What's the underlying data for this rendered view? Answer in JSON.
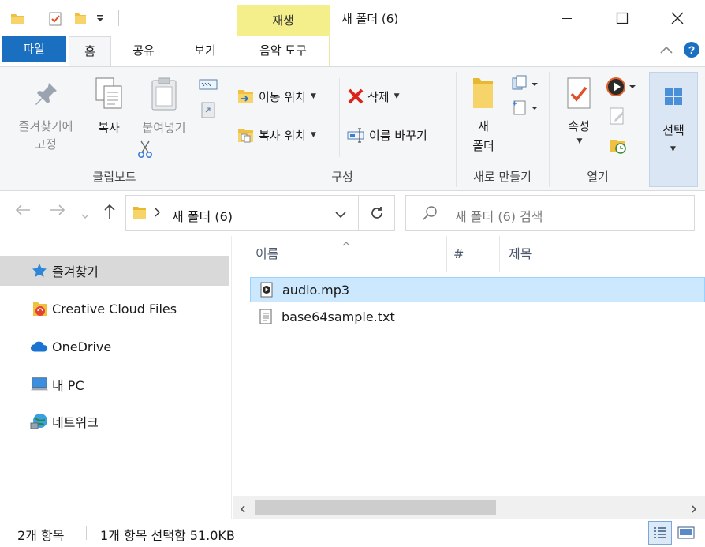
{
  "window": {
    "title": "새 폴더 (6)",
    "context_tab_group": "재생",
    "qat_icons": [
      "folder-icon",
      "properties-icon",
      "new-folder-icon",
      "qat-dropdown-icon"
    ],
    "controls": [
      "minimize-icon",
      "maximize-icon",
      "close-icon"
    ]
  },
  "tabs": {
    "file": "파일",
    "home": "홈",
    "share": "공유",
    "view": "보기",
    "music_tools": "음악 도구"
  },
  "ribbon": {
    "clipboard": {
      "pin_line1": "즐겨찾기에",
      "pin_line2": "고정",
      "copy": "복사",
      "paste": "붙여넣기",
      "label": "클립보드"
    },
    "organize": {
      "move_to": "이동 위치",
      "copy_to": "복사 위치",
      "delete": "삭제",
      "rename": "이름 바꾸기",
      "label": "구성"
    },
    "new": {
      "new_folder_line1": "새",
      "new_folder_line2": "폴더",
      "label": "새로 만들기"
    },
    "open": {
      "properties": "속성",
      "label": "열기"
    },
    "select": {
      "select": "선택"
    }
  },
  "address": {
    "path": "새 폴더 (6)",
    "search_placeholder": "새 폴더 (6) 검색"
  },
  "navpane": {
    "items": [
      {
        "label": "즐겨찾기",
        "icon": "star-icon"
      },
      {
        "label": "Creative Cloud Files",
        "icon": "creative-cloud-icon"
      },
      {
        "label": "OneDrive",
        "icon": "onedrive-icon"
      },
      {
        "label": "내 PC",
        "icon": "pc-icon"
      },
      {
        "label": "네트워크",
        "icon": "network-icon"
      }
    ]
  },
  "filelist": {
    "columns": [
      "이름",
      "#",
      "제목"
    ],
    "files": [
      {
        "name": "audio.mp3",
        "icon": "audio-file-icon",
        "selected": true
      },
      {
        "name": "base64sample.txt",
        "icon": "text-file-icon",
        "selected": false
      }
    ]
  },
  "status": {
    "item_count": "2개 항목",
    "selection": "1개 항목 선택함 51.0KB"
  },
  "colors": {
    "file_tab": "#1a6fc1",
    "context_tab": "#f4ef8a",
    "selection": "#cce8ff",
    "ribbon_bg": "#f5f6f7"
  }
}
